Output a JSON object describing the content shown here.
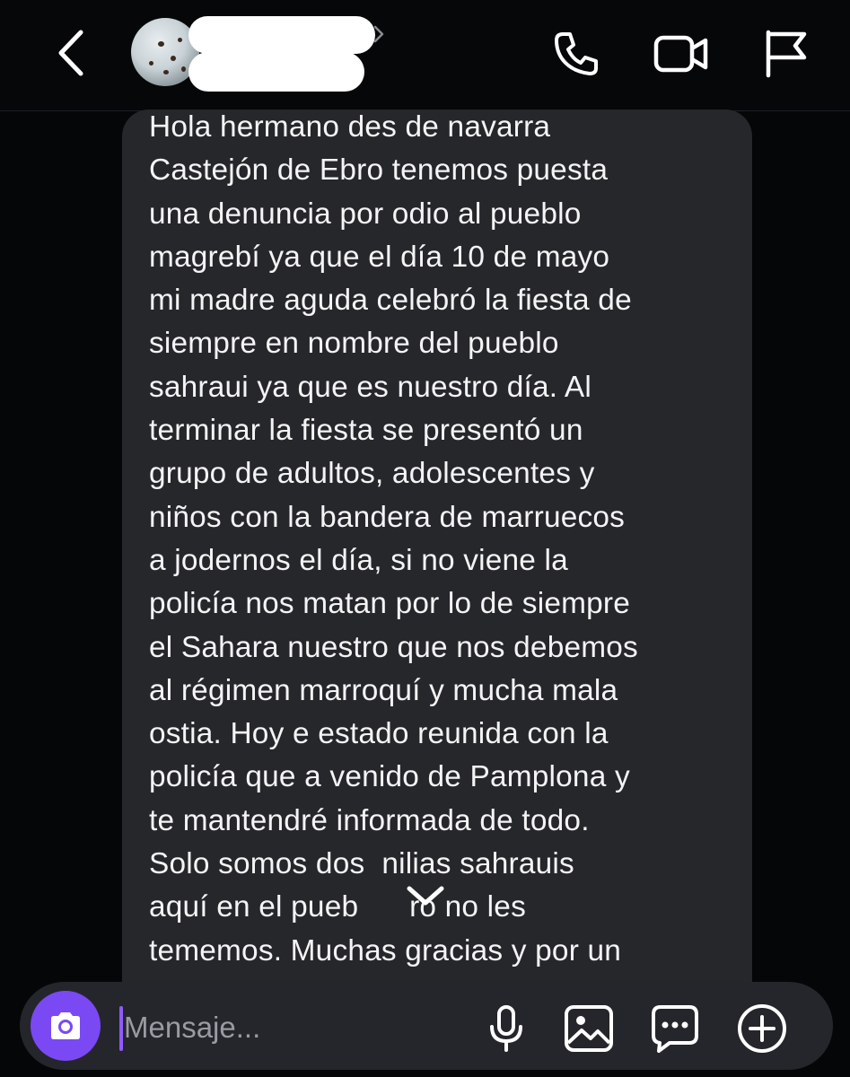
{
  "header": {
    "icons": {
      "back": "chevron-left-icon",
      "phone": "phone-icon",
      "video": "video-camera-icon",
      "report": "flag-icon"
    }
  },
  "message": {
    "lines": [
      "Hola hermano des de navarra",
      "Castejón de Ebro tenemos puesta",
      "una denuncia por odio al pueblo",
      "magrebí ya que el día 10 de mayo",
      "mi madre aguda celebró la fiesta de",
      "siempre en nombre del pueblo",
      "sahraui ya que es nuestro día. Al",
      "terminar la fiesta se presentó un",
      "grupo de adultos, adolescentes y",
      "niños con la bandera de marruecos",
      "a jodernos el día, si no viene la",
      "policía nos matan por lo de siempre",
      "el Sahara nuestro que nos debemos",
      "al régimen marroquí y mucha mala",
      "ostia. Hoy e estado reunida con la",
      "policía que a venido de Pamplona y",
      "te mantendré informada de todo.",
      "Solo somos dos  nilias sahrauis",
      "aquí en el pueb      ro no les",
      "tememos. Muchas gracias y por un"
    ]
  },
  "composer": {
    "placeholder": "Mensaje...",
    "icons": {
      "camera": "camera-icon",
      "mic": "microphone-icon",
      "gallery": "image-icon",
      "sticker": "chat-bubble-icon",
      "more": "plus-circle-icon",
      "scroll": "chevron-down-icon"
    }
  },
  "colors": {
    "background": "#050608",
    "bubble": "#26272b",
    "composer": "#25262b",
    "accent": "#7a49f3",
    "text": "#f4f4f5",
    "placeholder": "#9a9ba2"
  }
}
